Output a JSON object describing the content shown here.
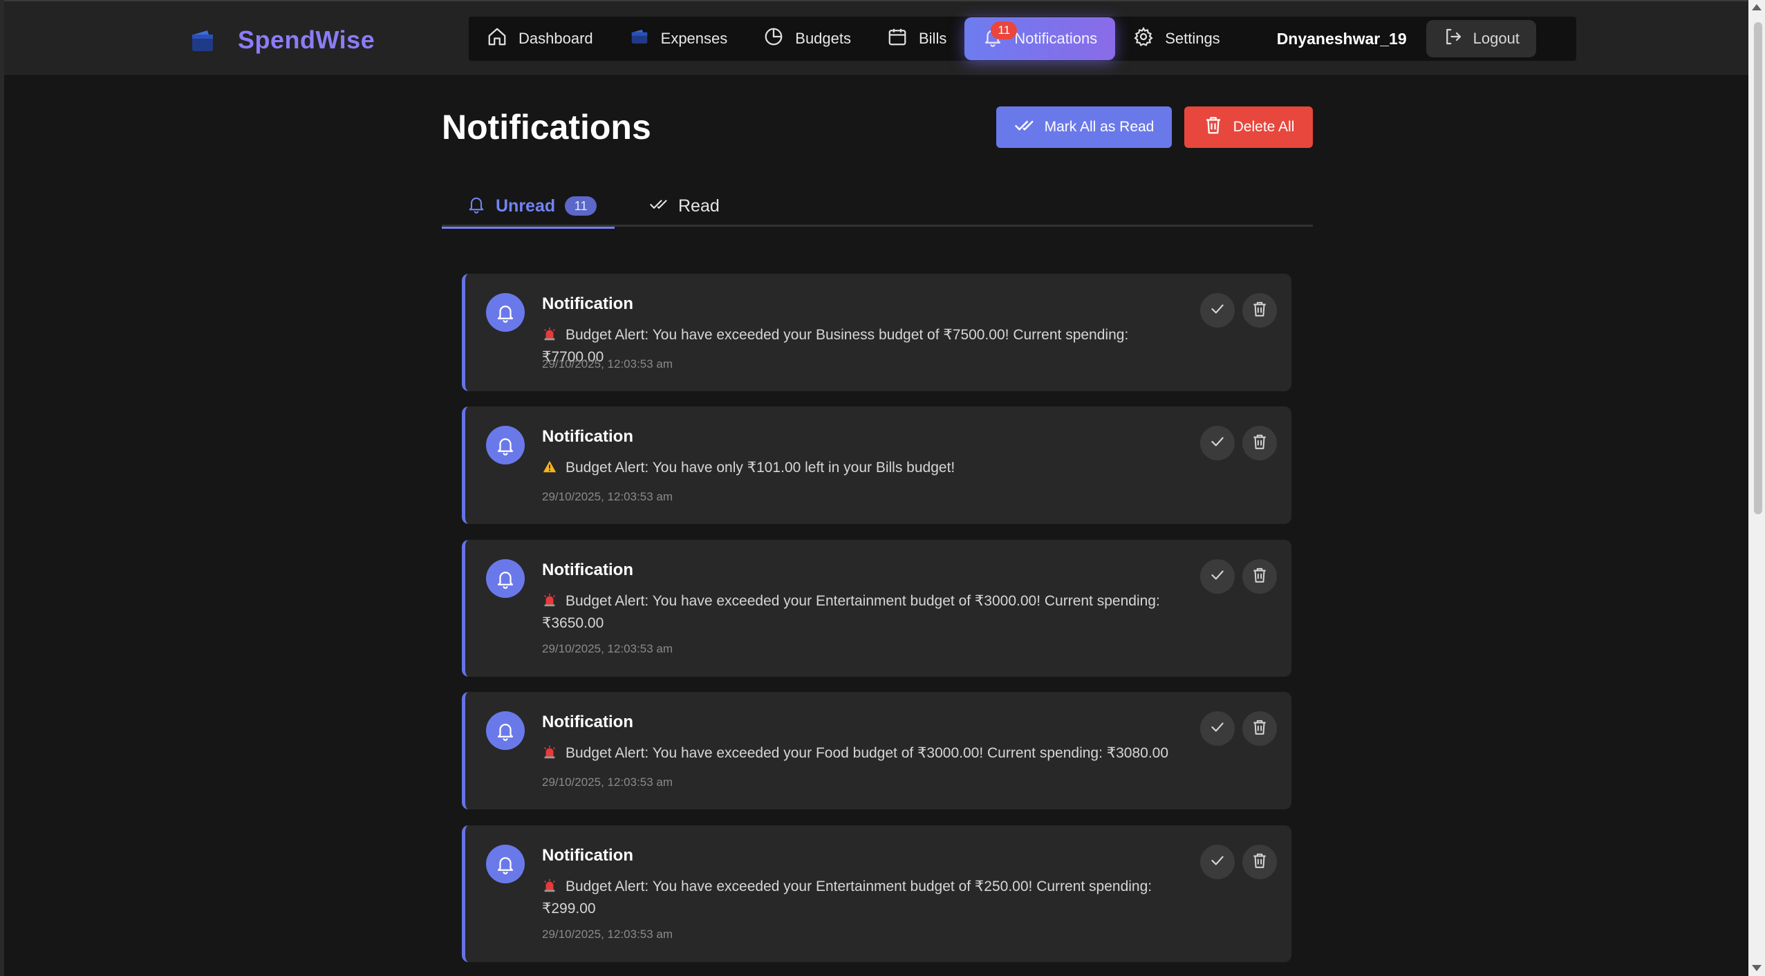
{
  "brand": {
    "name": "SpendWise"
  },
  "nav": {
    "items": [
      {
        "label": "Dashboard",
        "icon": "home-icon"
      },
      {
        "label": "Expenses",
        "icon": "wallet-icon"
      },
      {
        "label": "Budgets",
        "icon": "pie-chart-icon"
      },
      {
        "label": "Bills",
        "icon": "calendar-icon"
      },
      {
        "label": "Notifications",
        "icon": "bell-icon",
        "active": true,
        "badge": "11"
      },
      {
        "label": "Settings",
        "icon": "gear-icon"
      }
    ],
    "username": "Dnyaneshwar_19",
    "logout_label": "Logout"
  },
  "page": {
    "title": "Notifications",
    "mark_all_label": "Mark All as Read",
    "delete_all_label": "Delete All"
  },
  "tabs": {
    "unread_label": "Unread",
    "unread_count": "11",
    "read_label": "Read"
  },
  "notifications": [
    {
      "title": "Notification",
      "emoji": "siren",
      "message": "Budget Alert: You have exceeded your Business budget of ₹7500.00! Current spending: ₹7700.00",
      "time": "29/10/2025, 12:03:53 am"
    },
    {
      "title": "Notification",
      "emoji": "warning",
      "message": "Budget Alert: You have only ₹101.00 left in your Bills budget!",
      "time": "29/10/2025, 12:03:53 am"
    },
    {
      "title": "Notification",
      "emoji": "siren",
      "message": "Budget Alert: You have exceeded your Entertainment budget of ₹3000.00! Current spending: ₹3650.00",
      "time": "29/10/2025, 12:03:53 am"
    },
    {
      "title": "Notification",
      "emoji": "siren",
      "message": "Budget Alert: You have exceeded your Food budget of ₹3000.00! Current spending: ₹3080.00",
      "time": "29/10/2025, 12:03:53 am"
    },
    {
      "title": "Notification",
      "emoji": "siren",
      "message": "Budget Alert: You have exceeded your Entertainment budget of ₹250.00! Current spending: ₹299.00",
      "time": "29/10/2025, 12:03:53 am"
    }
  ],
  "colors": {
    "accent": "#6a79ea",
    "danger": "#e8473d",
    "background": "#161616",
    "card": "#282828"
  }
}
